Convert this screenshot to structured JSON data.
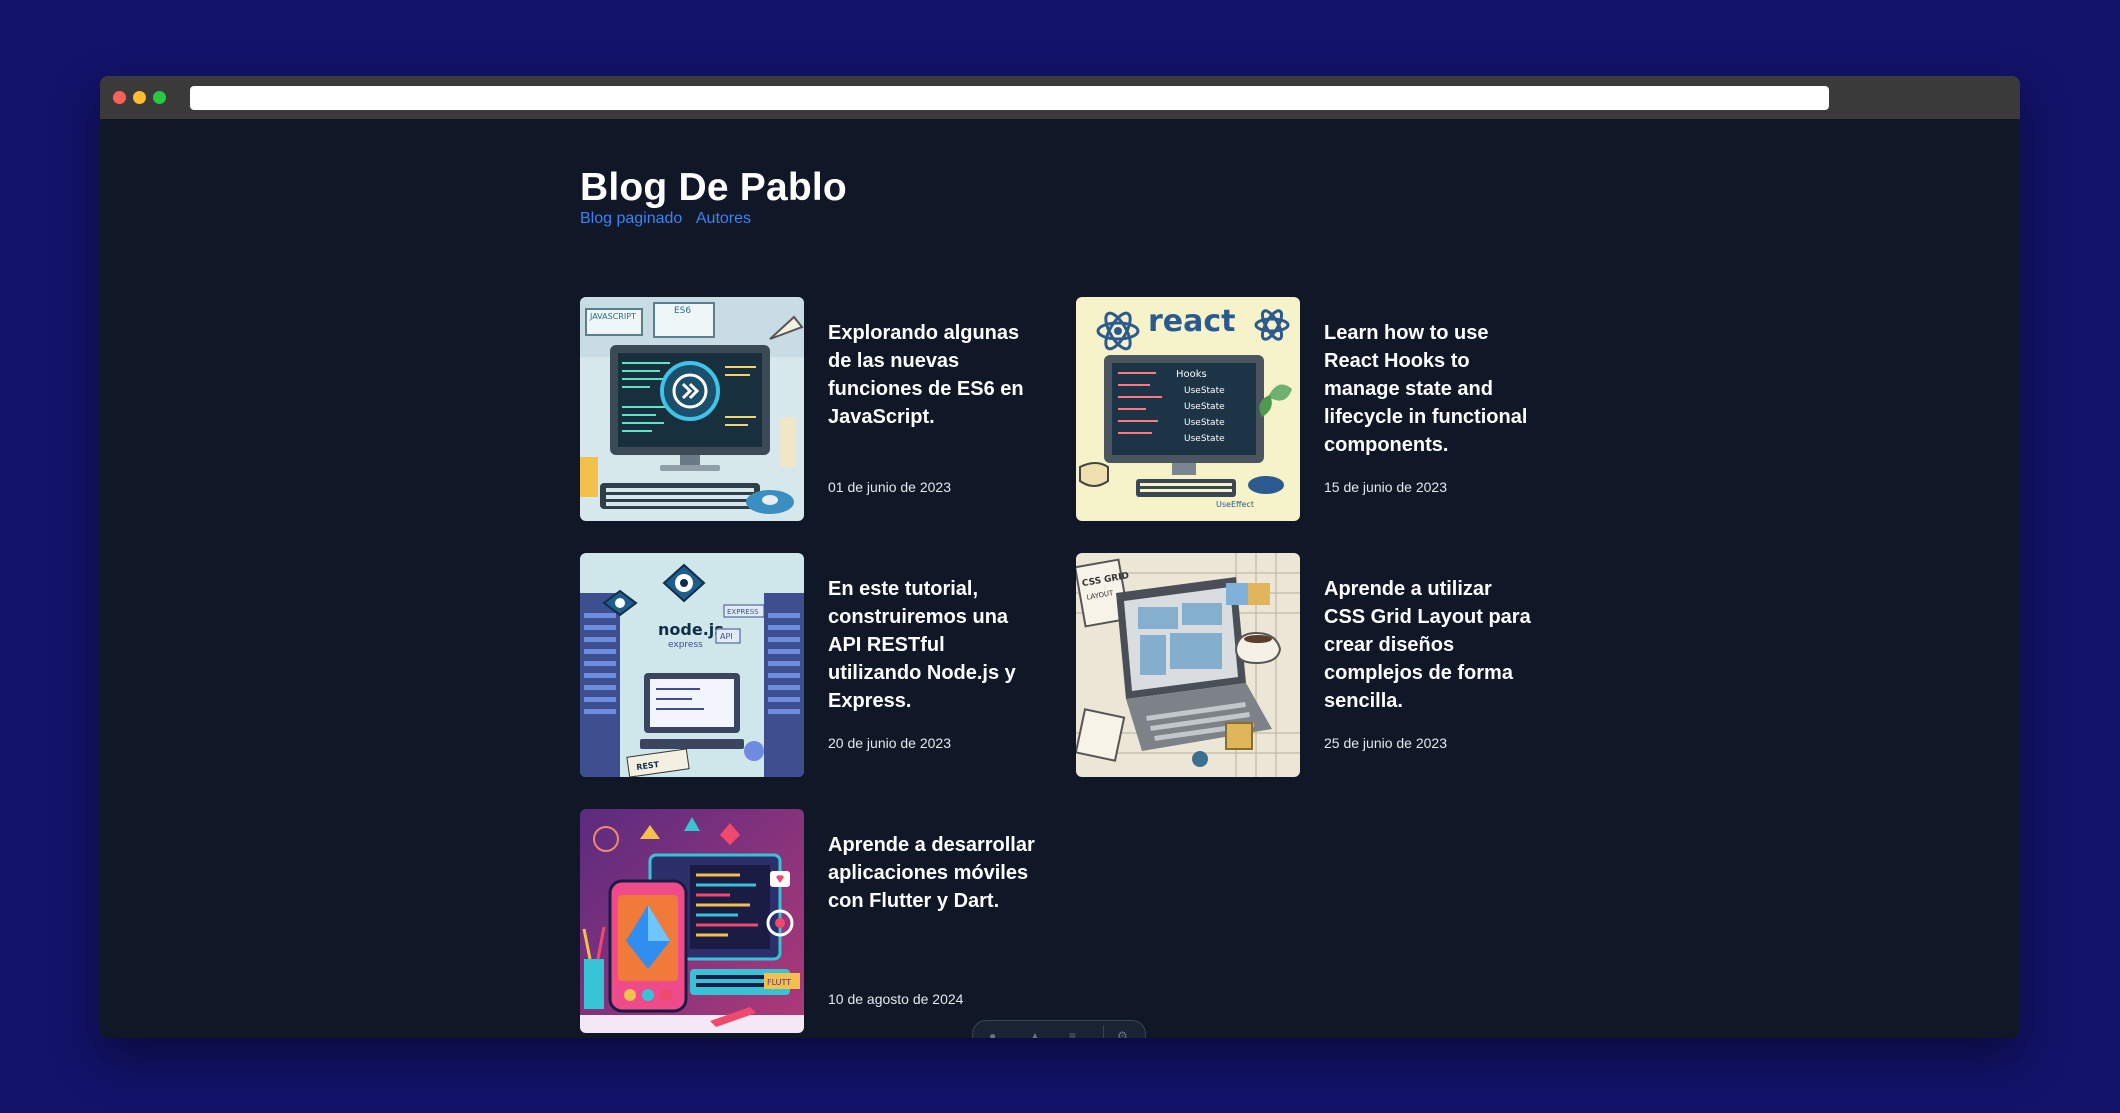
{
  "blog": {
    "title": "Blog De Pablo",
    "nav": [
      "Blog paginado",
      "Autores"
    ]
  },
  "posts": [
    {
      "title": "Explorando algunas de las nuevas funciones de ES6 en JavaScript.",
      "date": "01 de junio de 2023",
      "image_icon": "javascript-es6-illustration-icon"
    },
    {
      "title": "Learn how to use React Hooks to manage state and lifecycle in functional components.",
      "date": "15 de junio de 2023",
      "image_icon": "react-hooks-illustration-icon"
    },
    {
      "title": "En este tutorial, construiremos una API RESTful utilizando Node.js y Express.",
      "date": "20 de junio de 2023",
      "image_icon": "nodejs-express-illustration-icon"
    },
    {
      "title": "Aprende a utilizar CSS Grid Layout para crear diseños complejos de forma sencilla.",
      "date": "25 de junio de 2023",
      "image_icon": "css-grid-illustration-icon"
    },
    {
      "title": "Aprende a desarrollar aplicaciones móviles con Flutter y Dart.",
      "date": "10 de agosto de 2024",
      "image_icon": "flutter-dart-illustration-icon"
    }
  ],
  "thumb_text": {
    "js": [
      "JAVASCRIPT",
      "ES6"
    ],
    "react": [
      "react",
      "Hooks",
      "UseState",
      "UseEffect"
    ],
    "node": [
      "node.js",
      "express",
      "EXPRESS",
      "API",
      "REST"
    ],
    "css": [
      "CSS GRID",
      "LAYOUT"
    ],
    "flutter": [
      "FLUTT"
    ]
  },
  "colors": {
    "page_background": "#12136a",
    "app_background": "#101828",
    "link": "#3b82f6"
  }
}
